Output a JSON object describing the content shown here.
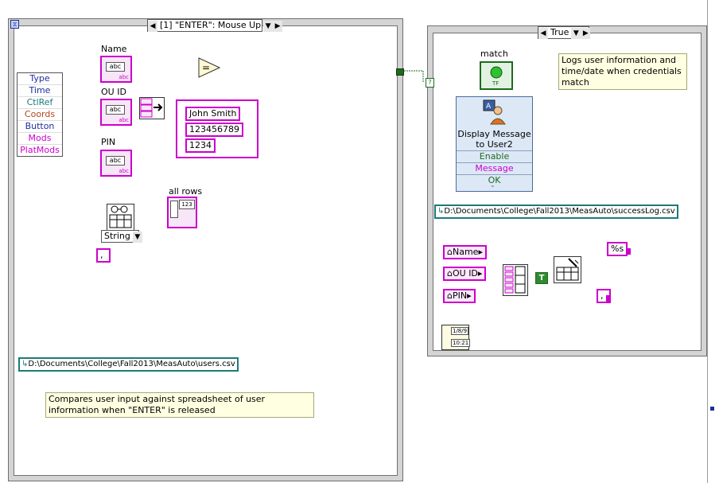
{
  "event_structure": {
    "selector_label": "[1] \"ENTER\": Mouse Up"
  },
  "case_structure": {
    "selector_label": "True"
  },
  "event_data_node": {
    "items": [
      "Type",
      "Time",
      "CtlRef",
      "Coords",
      "Button",
      "Mods",
      "PlatMods"
    ],
    "colors": [
      "#1d2f9b",
      "#1d2f9b",
      "#1d7a7a",
      "#b8421a",
      "#1d2f9b",
      "#cc00cc",
      "#cc00cc"
    ]
  },
  "controls": {
    "name_label": "Name",
    "ouid_label": "OU ID",
    "pin_label": "PIN",
    "abc": "abc"
  },
  "cluster_constant": {
    "values": [
      "John Smith",
      "123456789",
      "1234"
    ]
  },
  "read_spreadsheet": {
    "type_selector": "String",
    "delimiter": ",",
    "all_rows_label": "all rows",
    "all_rows_tag": "123",
    "file_path": "D:\\Documents\\College\\Fall2013\\MeasAuto\\users.csv"
  },
  "notes": {
    "left": "Compares user input against spreadsheet of user information when \"ENTER\" is released",
    "right": "Logs user information and time/date when credentials match"
  },
  "match_indicator": {
    "label": "match",
    "tag": "TF"
  },
  "display_message": {
    "title": "Display Message to User2",
    "terminals": [
      "Enable",
      "Message",
      "OK"
    ]
  },
  "write_spreadsheet": {
    "file_path": "D:\\Documents\\College\\Fall2013\\MeasAuto\\successLog.csv",
    "locals": [
      "Name",
      "OU ID",
      "PIN"
    ],
    "format": "%s",
    "delimiter": ",",
    "bool_const": "T"
  },
  "time_node": {
    "date_tag": "1/8/9",
    "time_tag": "10:21"
  }
}
